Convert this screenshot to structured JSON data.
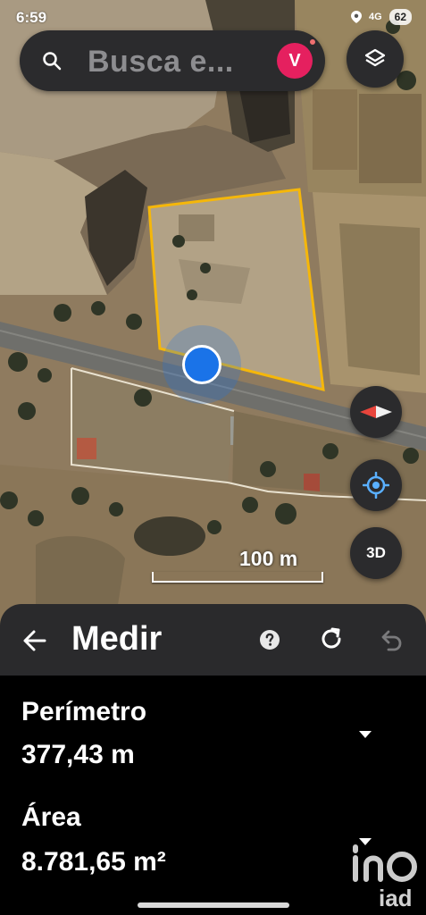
{
  "status": {
    "time": "6:59",
    "network": "4G",
    "battery": "62"
  },
  "search": {
    "placeholder": "Busca e...",
    "avatar_letter": "V"
  },
  "map": {
    "scale_label": "100 m",
    "compass_color": "#e8453c",
    "polygon_color": "#f5b70a",
    "location_color": "#1a73e8",
    "button_3d": "3D",
    "icons": [
      "layers-icon",
      "compass-icon",
      "my-location-icon"
    ]
  },
  "measure": {
    "title": "Medir",
    "icons": [
      "back-arrow-icon",
      "help-icon",
      "reset-icon",
      "undo-icon"
    ],
    "perimeter_label": "Perímetro",
    "perimeter_value": "377,43 m",
    "area_label": "Área",
    "area_value": "8.781,65 m²"
  },
  "watermark": {
    "text": "iad"
  }
}
